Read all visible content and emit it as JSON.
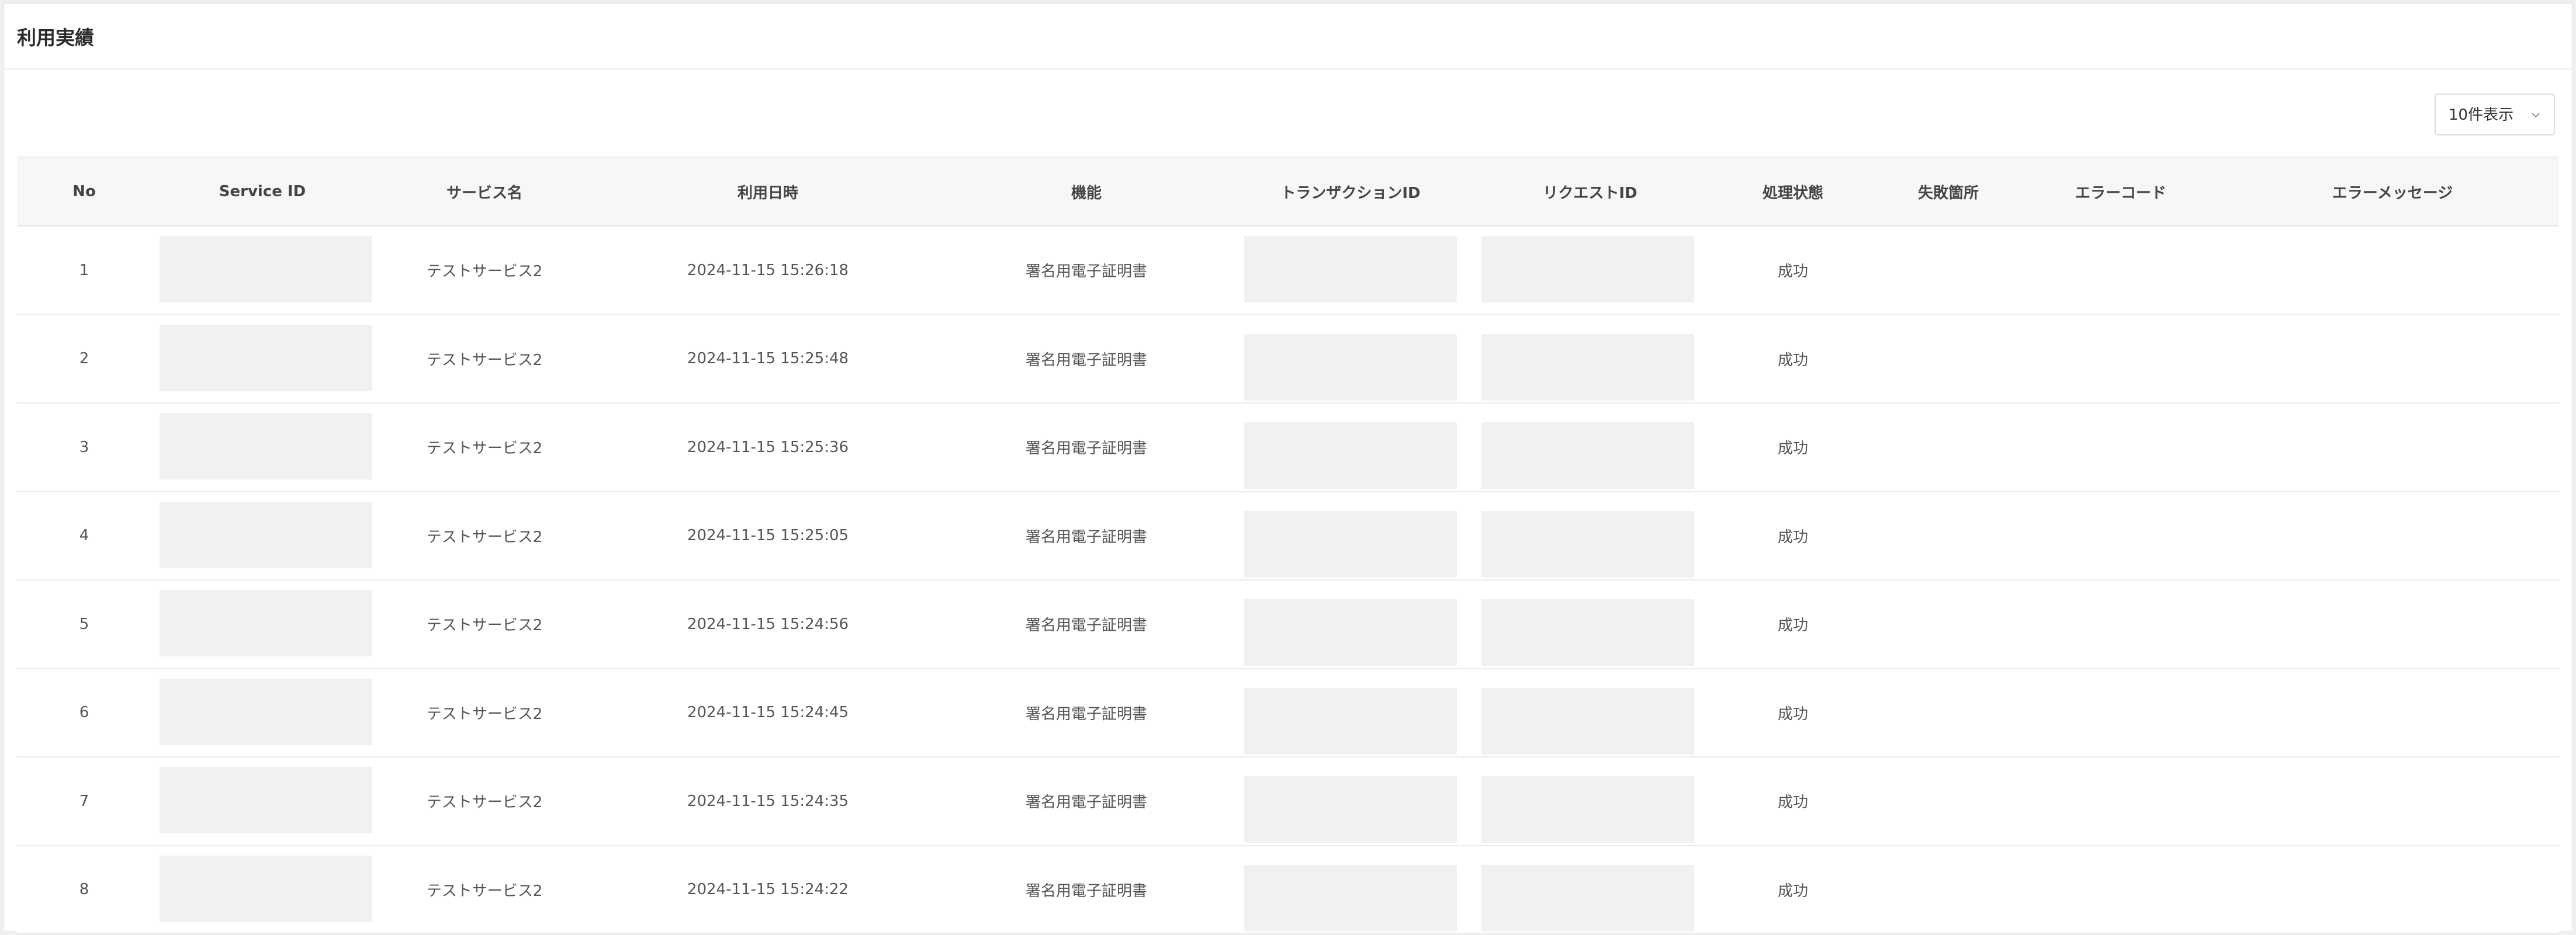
{
  "title": "利用実績",
  "page_size": {
    "selected": "10件表示"
  },
  "columns": {
    "no": "No",
    "service_id": "Service ID",
    "service_name": "サービス名",
    "used_at": "利用日時",
    "function": "機能",
    "transaction_id": "トランザクションID",
    "request_id": "リクエストID",
    "status": "処理状態",
    "failure_point": "失敗箇所",
    "error_code": "エラーコード",
    "error_message": "エラーメッセージ"
  },
  "rows": [
    {
      "no": "1",
      "service_name": "テストサービス2",
      "used_at": "2024-11-15 15:26:18",
      "function": "署名用電子証明書",
      "status": "成功",
      "failure_point": "",
      "error_code": "",
      "error_message": ""
    },
    {
      "no": "2",
      "service_name": "テストサービス2",
      "used_at": "2024-11-15 15:25:48",
      "function": "署名用電子証明書",
      "status": "成功",
      "failure_point": "",
      "error_code": "",
      "error_message": ""
    },
    {
      "no": "3",
      "service_name": "テストサービス2",
      "used_at": "2024-11-15 15:25:36",
      "function": "署名用電子証明書",
      "status": "成功",
      "failure_point": "",
      "error_code": "",
      "error_message": ""
    },
    {
      "no": "4",
      "service_name": "テストサービス2",
      "used_at": "2024-11-15 15:25:05",
      "function": "署名用電子証明書",
      "status": "成功",
      "failure_point": "",
      "error_code": "",
      "error_message": ""
    },
    {
      "no": "5",
      "service_name": "テストサービス2",
      "used_at": "2024-11-15 15:24:56",
      "function": "署名用電子証明書",
      "status": "成功",
      "failure_point": "",
      "error_code": "",
      "error_message": ""
    },
    {
      "no": "6",
      "service_name": "テストサービス2",
      "used_at": "2024-11-15 15:24:45",
      "function": "署名用電子証明書",
      "status": "成功",
      "failure_point": "",
      "error_code": "",
      "error_message": ""
    },
    {
      "no": "7",
      "service_name": "テストサービス2",
      "used_at": "2024-11-15 15:24:35",
      "function": "署名用電子証明書",
      "status": "成功",
      "failure_point": "",
      "error_code": "",
      "error_message": ""
    },
    {
      "no": "8",
      "service_name": "テストサービス2",
      "used_at": "2024-11-15 15:24:22",
      "function": "署名用電子証明書",
      "status": "成功",
      "failure_point": "",
      "error_code": "",
      "error_message": ""
    }
  ],
  "icons": {
    "page_size_toggle": "chevron-down-icon"
  },
  "colors": {
    "header_bg": "#f7f7f9",
    "masked_bg": "#f1f1f1",
    "border": "#ececef"
  }
}
